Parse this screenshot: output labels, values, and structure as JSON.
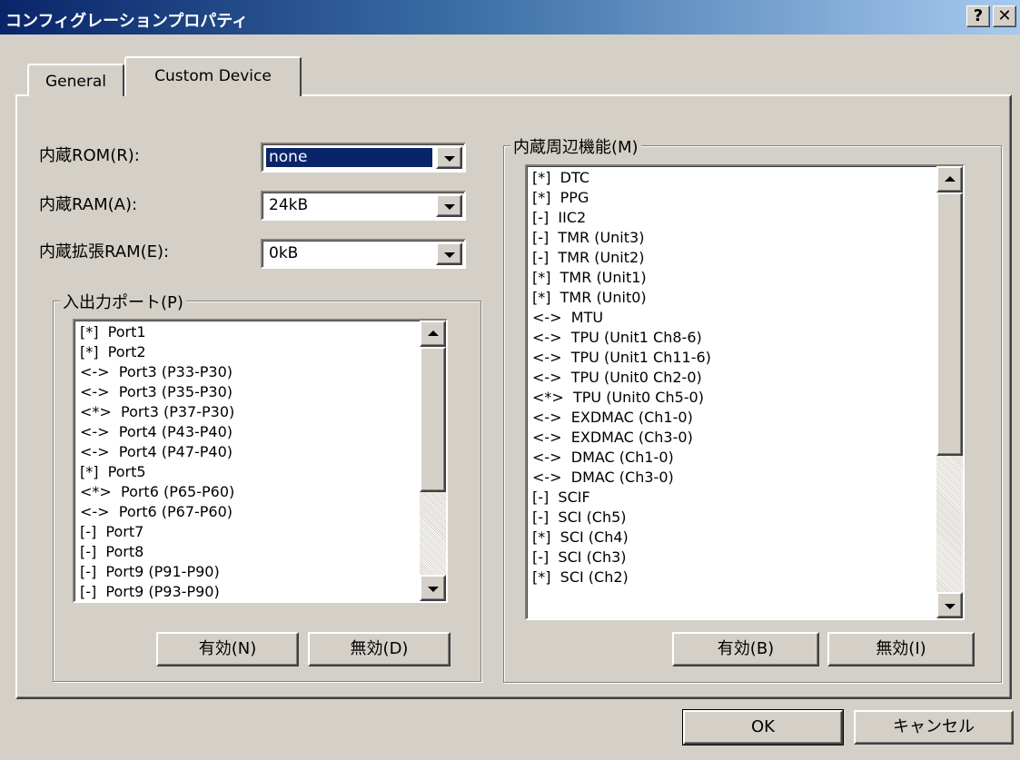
{
  "window": {
    "title": "コンフィグレーションプロパティ",
    "help_button": "?",
    "close_button": "✕"
  },
  "tabs": [
    {
      "label": "General",
      "active": false
    },
    {
      "label": "Custom Device",
      "active": true
    }
  ],
  "fields": {
    "rom": {
      "label": "内蔵ROM(R):",
      "value": "none"
    },
    "ram": {
      "label": "内蔵RAM(A):",
      "value": "24kB"
    },
    "ext_ram": {
      "label": "内蔵拡張RAM(E):",
      "value": "0kB"
    }
  },
  "ports": {
    "legend": "入出力ポート(P)",
    "items": [
      "[*]  Port1",
      "[*]  Port2",
      "<->  Port3 (P33-P30)",
      "<->  Port3 (P35-P30)",
      "<*>  Port3 (P37-P30)",
      "<->  Port4 (P43-P40)",
      "<->  Port4 (P47-P40)",
      "[*]  Port5",
      "<*>  Port6 (P65-P60)",
      "<->  Port6 (P67-P60)",
      "[-]  Port7",
      "[-]  Port8",
      "[-]  Port9 (P91-P90)",
      "[-]  Port9 (P93-P90)"
    ],
    "enable_button": "有効(N)",
    "disable_button": "無効(D)"
  },
  "peripherals": {
    "legend": "内蔵周辺機能(M)",
    "items": [
      "[*]  DTC",
      "[*]  PPG",
      "[-]  IIC2",
      "[-]  TMR (Unit3)",
      "[-]  TMR (Unit2)",
      "[*]  TMR (Unit1)",
      "[*]  TMR (Unit0)",
      "<->  MTU",
      "<->  TPU (Unit1 Ch8-6)",
      "<->  TPU (Unit1 Ch11-6)",
      "<->  TPU (Unit0 Ch2-0)",
      "<*>  TPU (Unit0 Ch5-0)",
      "<->  EXDMAC (Ch1-0)",
      "<->  EXDMAC (Ch3-0)",
      "<->  DMAC (Ch1-0)",
      "<->  DMAC (Ch3-0)",
      "[-]  SCIF",
      "[-]  SCI (Ch5)",
      "[*]  SCI (Ch4)",
      "[-]  SCI (Ch3)",
      "[*]  SCI (Ch2)"
    ],
    "enable_button": "有効(B)",
    "disable_button": "無効(I)"
  },
  "footer": {
    "ok_button": "OK",
    "cancel_button": "キャンセル"
  }
}
